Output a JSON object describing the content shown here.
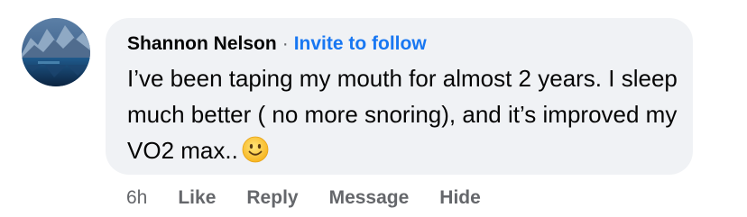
{
  "comment": {
    "author": "Shannon Nelson",
    "separator": "·",
    "invite_label": "Invite to follow",
    "text": "I’ve been taping my mouth for almost 2 years. I sleep much better ( no more snoring), and it’s improved my VO2 max..",
    "emoji": "slightly-smiling-face-icon",
    "timestamp": "6h",
    "actions": {
      "like": "Like",
      "reply": "Reply",
      "message": "Message",
      "hide": "Hide"
    }
  },
  "colors": {
    "bubble_background": "#f0f2f5",
    "text": "#050505",
    "secondary_text": "#65676b",
    "link": "#1877f2"
  }
}
